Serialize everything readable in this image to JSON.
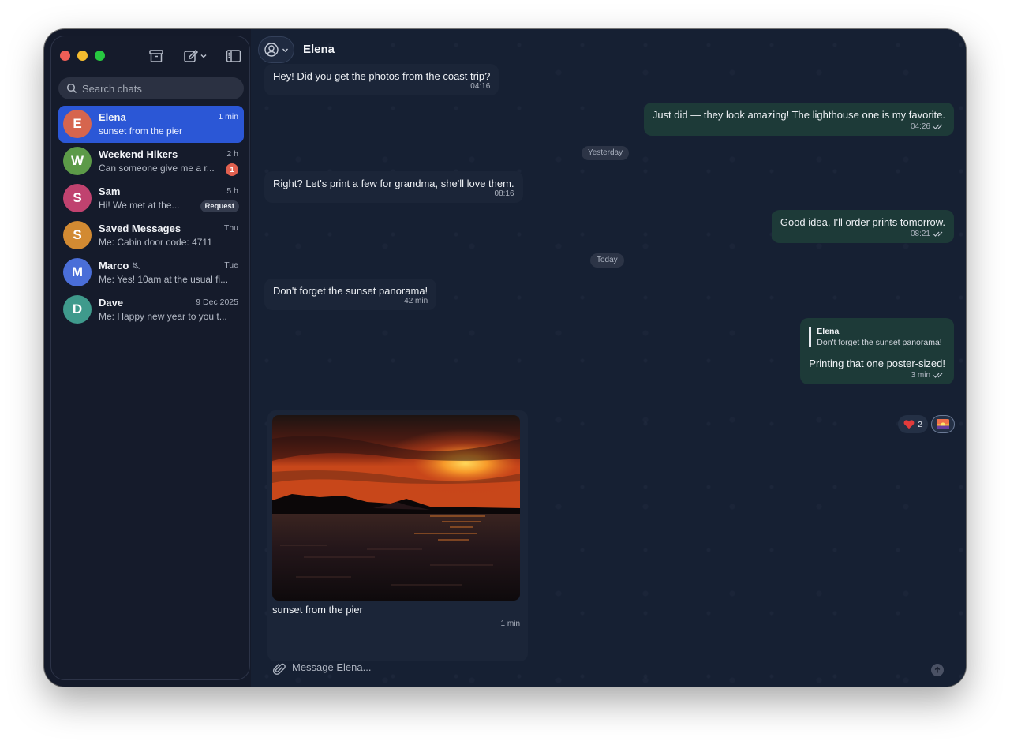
{
  "sidebar": {
    "search_placeholder": "Search chats",
    "chats": [
      {
        "initial": "E",
        "name": "Elena",
        "time": "1 min",
        "preview": "sunset from the pier",
        "color": "#d6654e",
        "active": true
      },
      {
        "initial": "W",
        "name": "Weekend Hikers",
        "time": "2 h",
        "preview": "Can someone give me a r...",
        "color": "#5c9a48",
        "unread": "1"
      },
      {
        "initial": "S",
        "name": "Sam",
        "time": "5 h",
        "preview": "Hi! We met at the...",
        "color": "#c0426f",
        "badge": "Request"
      },
      {
        "initial": "S",
        "name": "Saved Messages",
        "time": "Thu",
        "preview": "Me: Cabin door code: 4711",
        "color": "#d28a32"
      },
      {
        "initial": "M",
        "name": "Marco",
        "time": "Tue",
        "preview": "Me: Yes! 10am at the usual fi...",
        "color": "#4a6ed8",
        "muted": true
      },
      {
        "initial": "D",
        "name": "Dave",
        "time": "9 Dec 2025",
        "preview": "Me: Happy new year to you t...",
        "color": "#3f9a8c"
      }
    ]
  },
  "header": {
    "title": "Elena"
  },
  "messages": {
    "m1": {
      "text": "Hey! Did you get the photos from the coast trip?",
      "time": "04:16"
    },
    "m2": {
      "text": "Just did — they look amazing! The lighthouse one is my favorite.",
      "time": "04:26"
    },
    "date1": "Yesterday",
    "m3": {
      "text": "Right? Let's print a few for grandma, she'll love them.",
      "time": "08:16"
    },
    "m4": {
      "text": "Good idea, I'll order prints tomorrow.",
      "time": "08:21"
    },
    "date2": "Today",
    "m5": {
      "text": "Don't forget the sunset panorama!",
      "time": "42 min"
    },
    "m6": {
      "reply_name": "Elena",
      "reply_text": "Don't forget the sunset panorama!",
      "text": "Printing that one poster-sized!",
      "time": "3 min"
    },
    "reactions": {
      "heart_count": "2"
    },
    "photo": {
      "caption": "sunset from the pier",
      "time": "1 min"
    }
  },
  "composer": {
    "placeholder": "Message Elena..."
  }
}
